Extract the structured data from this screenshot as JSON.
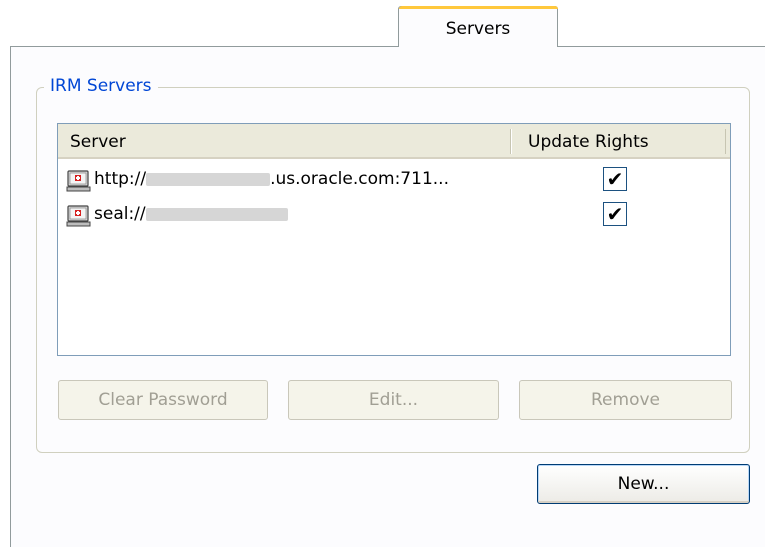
{
  "tab": {
    "label": "Servers",
    "accent": "#ffc83c"
  },
  "group": {
    "legend": "IRM Servers",
    "legend_color": "#0046d5"
  },
  "list": {
    "columns": [
      "Server",
      "Update Rights"
    ],
    "rows": [
      {
        "server_prefix": "http://",
        "server_suffix": ".us.oracle.com:711...",
        "update_rights": "✔",
        "icon": "server-icon"
      },
      {
        "server_prefix": "seal://",
        "server_suffix": "",
        "update_rights": "✔",
        "icon": "server-icon"
      }
    ]
  },
  "buttons": {
    "clear_password": "Clear Password",
    "edit": "Edit...",
    "remove": "Remove",
    "new": "New..."
  }
}
